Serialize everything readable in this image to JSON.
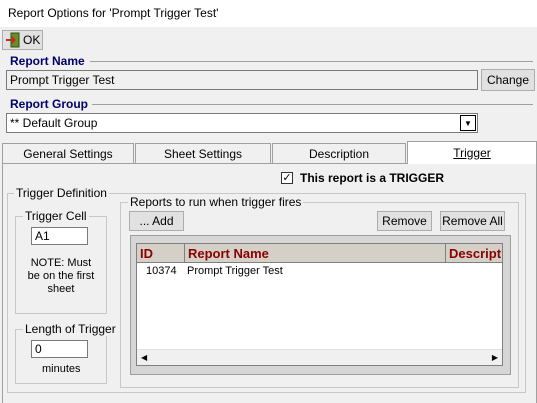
{
  "window": {
    "title": "Report Options for 'Prompt Trigger Test'"
  },
  "toolbar": {
    "ok_label": "OK"
  },
  "report_name": {
    "section_label": "Report Name",
    "value": "Prompt Trigger Test",
    "change_label": "Change"
  },
  "report_group": {
    "section_label": "Report Group",
    "value": "** Default Group"
  },
  "tabs": [
    {
      "label": "General Settings"
    },
    {
      "label": "Sheet Settings"
    },
    {
      "label": "Description"
    },
    {
      "label": "Trigger"
    }
  ],
  "trigger": {
    "is_trigger_label": "This report is a TRIGGER",
    "is_trigger_checked": true,
    "definition_label": "Trigger Definition",
    "cell_group_label": "Trigger Cell",
    "cell_value": "A1",
    "note": "NOTE: Must be on the first sheet",
    "length_group_label": "Length of Trigger",
    "length_value": "0",
    "length_unit": "minutes",
    "reports_group_label": "Reports to run when trigger fires",
    "add_label": "... Add",
    "remove_label": "Remove",
    "remove_all_label": "Remove All",
    "list": {
      "columns": [
        "ID",
        "Report Name",
        "Descript"
      ],
      "rows": [
        {
          "id": "10374",
          "name": "Prompt Trigger Test"
        }
      ]
    }
  }
}
